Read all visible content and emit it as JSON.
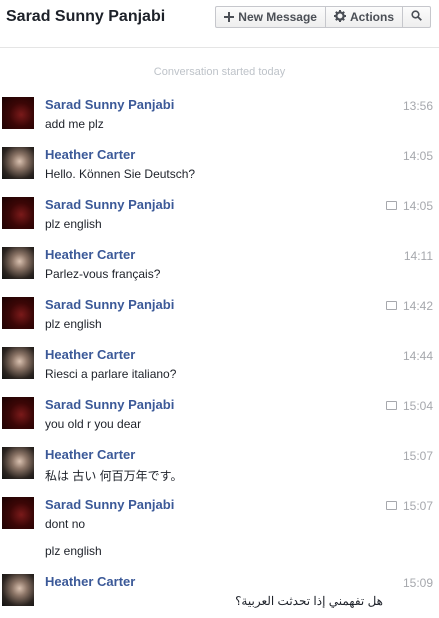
{
  "header": {
    "title": "Sarad Sunny Panjabi",
    "new_message_label": "New Message",
    "actions_label": "Actions",
    "new_message_icon": "plus-icon",
    "actions_icon": "gear-icon",
    "search_icon": "search-icon"
  },
  "conversation": {
    "started_label": "Conversation started today",
    "messages": [
      {
        "sender": "Sarad Sunny Panjabi",
        "time": "13:56",
        "text": "add me plz",
        "seen": false
      },
      {
        "sender": "Heather Carter",
        "time": "14:05",
        "text": "Hello. Können Sie Deutsch?",
        "seen": false
      },
      {
        "sender": "Sarad Sunny Panjabi",
        "time": "14:05",
        "text": "plz english",
        "seen": true
      },
      {
        "sender": "Heather Carter",
        "time": "14:11",
        "text": "Parlez-vous français?",
        "seen": false
      },
      {
        "sender": "Sarad Sunny Panjabi",
        "time": "14:42",
        "text": "plz english",
        "seen": true
      },
      {
        "sender": "Heather Carter",
        "time": "14:44",
        "text": "Riesci a parlare italiano?",
        "seen": false
      },
      {
        "sender": "Sarad Sunny Panjabi",
        "time": "15:04",
        "text": "you old r you dear",
        "seen": true
      },
      {
        "sender": "Heather Carter",
        "time": "15:07",
        "text": "私は 古い 何百万年です。",
        "seen": false
      },
      {
        "sender": "Sarad Sunny Panjabi",
        "time": "15:07",
        "text": "dont no",
        "text2": "plz english",
        "seen": true
      },
      {
        "sender": "Heather Carter",
        "time": "15:09",
        "text": "هل تفهمني إذا تحدثت العربية؟",
        "seen": false
      }
    ]
  }
}
